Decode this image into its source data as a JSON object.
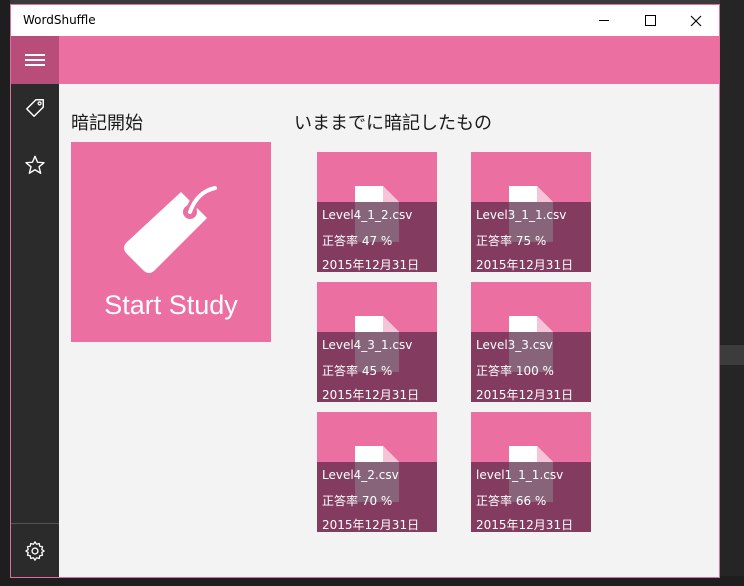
{
  "window": {
    "title": "WordShuffle"
  },
  "nav": {
    "items": [
      {
        "icon": "hamburger-icon"
      },
      {
        "icon": "tag-icon"
      },
      {
        "icon": "star-icon"
      },
      {
        "icon": "gear-icon"
      }
    ]
  },
  "start_section": {
    "heading": "暗記開始",
    "tile_label": "Start Study"
  },
  "history_section": {
    "heading": "いままでに暗記したもの",
    "files": [
      {
        "name": "Level4_1_2.csv",
        "rate": "正答率 47 %",
        "date": "2015年12月31日"
      },
      {
        "name": "Level3_1_1.csv",
        "rate": "正答率 75 %",
        "date": "2015年12月31日"
      },
      {
        "name": "Level4_3_1.csv",
        "rate": "正答率 45 %",
        "date": "2015年12月31日"
      },
      {
        "name": "Level3_3.csv",
        "rate": "正答率 100 %",
        "date": "2015年12月31日"
      },
      {
        "name": "Level4_2.csv",
        "rate": "正答率 70 %",
        "date": "2015年12月31日"
      },
      {
        "name": "level1_1_1.csv",
        "rate": "正答率 66 %",
        "date": "2015年12月31日"
      }
    ]
  },
  "colors": {
    "accent": "#ec6fa1",
    "nav_selected": "#b94d7a",
    "nav_bg": "#2b2b2b"
  }
}
